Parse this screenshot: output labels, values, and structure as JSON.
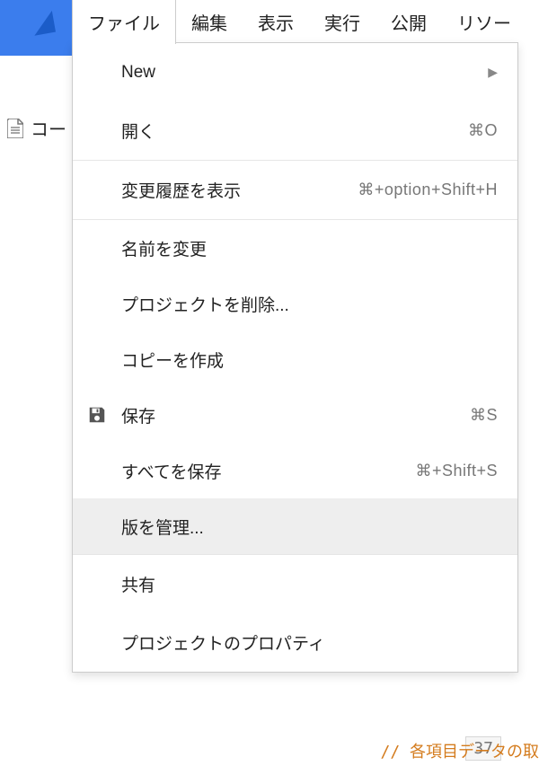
{
  "menubar": {
    "items": [
      {
        "label": "ファイル"
      },
      {
        "label": "編集"
      },
      {
        "label": "表示"
      },
      {
        "label": "実行"
      },
      {
        "label": "公開"
      },
      {
        "label": "リソー"
      }
    ]
  },
  "sidebar": {
    "label": "コー"
  },
  "dropdown": {
    "items": [
      {
        "label": "New",
        "shortcut": "",
        "hasSubmenu": true
      },
      {
        "label": "開く",
        "shortcut": "⌘O"
      },
      {
        "sep": true
      },
      {
        "label": "変更履歴を表示",
        "shortcut": "⌘+option+Shift+H"
      },
      {
        "sep": true
      },
      {
        "label": "名前を変更"
      },
      {
        "label": "プロジェクトを削除..."
      },
      {
        "label": "コピーを作成"
      },
      {
        "label": "保存",
        "shortcut": "⌘S",
        "icon": "save"
      },
      {
        "label": "すべてを保存",
        "shortcut": "⌘+Shift+S"
      },
      {
        "label": "版を管理...",
        "highlight": true
      },
      {
        "sep": true
      },
      {
        "label": "共有"
      },
      {
        "label": "プロジェクトのプロパティ"
      }
    ]
  },
  "code": {
    "lineNumber": "37",
    "comment": "// 各項目データの取"
  }
}
